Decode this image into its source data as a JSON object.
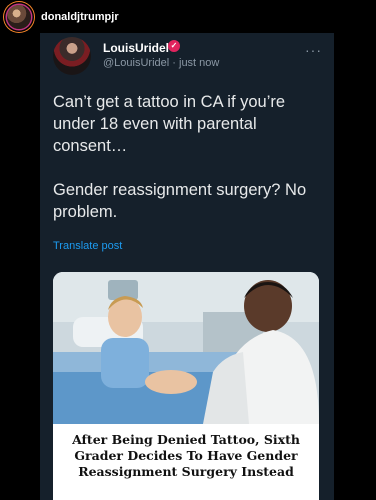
{
  "instagram": {
    "username": "donaldjtrumpjr"
  },
  "tweet": {
    "display_name": "LouisUridel",
    "verified_mark": "✓",
    "handle": "@LouisUridel",
    "separator": "·",
    "time": "just now",
    "more_glyph": "···",
    "text": "Can’t get a tattoo in CA if you’re under 18 even with parental consent…\n\nGender reassignment surgery? No problem.",
    "translate_label": "Translate post"
  },
  "article": {
    "headline": "After Being Denied Tattoo, Sixth Grader Decides To Have Gender Reassignment Surgery Instead"
  },
  "colors": {
    "background": "#000000",
    "card": "#15202b",
    "link": "#1d9bf0",
    "verified_badge": "#e0245e",
    "muted_text": "#8b98a5"
  },
  "icons": [
    "story-avatar",
    "profile-avatar",
    "verified-badge-icon",
    "more-options-icon"
  ]
}
